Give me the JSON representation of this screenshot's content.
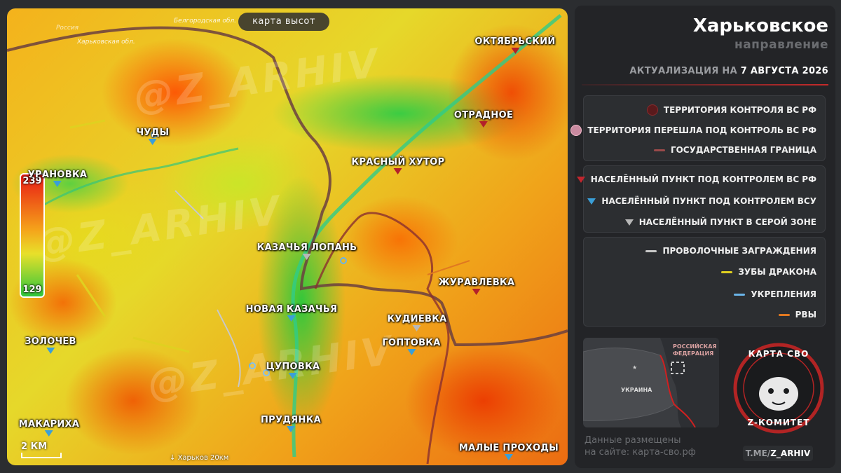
{
  "map": {
    "pill_label": "карта высот",
    "watermark": "@Z_ARHIV",
    "region_labels": {
      "border_ru": "Белгородская обл.",
      "border_ua_ru": "Россия",
      "border_ua": "Харьковская обл."
    },
    "scale_label": "2 КМ",
    "kharkiv_hint": "Харьков 20км",
    "elevation": {
      "max": "239",
      "min": "129"
    },
    "settlements": [
      {
        "name": "ОКТЯБРЬСКИЙ",
        "control": "rf"
      },
      {
        "name": "ОТРАДНОЕ",
        "control": "rf"
      },
      {
        "name": "КРАСНЫЙ ХУТОР",
        "control": "rf"
      },
      {
        "name": "ЧУДЫ",
        "control": "ua"
      },
      {
        "name": "УРАНОВКА",
        "control": "ua"
      },
      {
        "name": "КАЗАЧЬЯ ЛОПАНЬ",
        "control": "grey"
      },
      {
        "name": "ЖУРАВЛЕВКА",
        "control": "rf"
      },
      {
        "name": "НОВАЯ КАЗАЧЬЯ",
        "control": "ua"
      },
      {
        "name": "КУДИЕВКА",
        "control": "grey"
      },
      {
        "name": "ГОПТОВКА",
        "control": "ua"
      },
      {
        "name": "ЗОЛОЧЕВ",
        "control": "ua"
      },
      {
        "name": "ЦУПОВКА",
        "control": "ua"
      },
      {
        "name": "ПРУДЯНКА",
        "control": "ua"
      },
      {
        "name": "МАКАРИХА",
        "control": "ua"
      },
      {
        "name": "МАЛЫЕ ПРОХОДЫ",
        "control": "ua"
      }
    ]
  },
  "side": {
    "title": "Харьковское",
    "subtitle": "направление",
    "updated_prefix": "АКТУАЛИЗАЦИЯ НА",
    "updated_date": "7 АВГУСТА 2026",
    "legend_territory": [
      {
        "label": "ТЕРРИТОРИЯ КОНТРОЛЯ ВС РФ",
        "symbol": "circle",
        "color": "#5a1a1c",
        "border": "#8a2a2c"
      },
      {
        "label": "ТЕРРИТОРИЯ ПЕРЕШЛА ПОД КОНТРОЛЬ ВС РФ",
        "symbol": "circle",
        "color": "#c98aa0",
        "border": "#f0b8c8"
      },
      {
        "label": "ГОСУДАРСТВЕННАЯ ГРАНИЦА",
        "symbol": "line",
        "color": "#9a4a4a"
      }
    ],
    "legend_settlements": [
      {
        "label": "НАСЕЛЁННЫЙ ПУНКТ ПОД КОНТРОЛЕМ ВС РФ",
        "symbol": "triangle",
        "color": "#c0262e"
      },
      {
        "label": "НАСЕЛЁННЫЙ ПУНКТ ПОД КОНТРОЛЕМ ВСУ",
        "symbol": "triangle",
        "color": "#3a9fd8"
      },
      {
        "label": "НАСЕЛЁННЫЙ ПУНКТ В СЕРОЙ ЗОНЕ",
        "symbol": "triangle",
        "color": "#b8b8b8"
      }
    ],
    "legend_fortifications": [
      {
        "label": "ПРОВОЛОЧНЫЕ ЗАГРАЖДЕНИЯ",
        "symbol": "line",
        "color": "#c8c8c8"
      },
      {
        "label": "ЗУБЫ ДРАКОНА",
        "symbol": "line",
        "color": "#e0d020"
      },
      {
        "label": "УКРЕПЛЕНИЯ",
        "symbol": "line",
        "color": "#6ab4e8"
      },
      {
        "label": "РВЫ",
        "symbol": "line",
        "color": "#e07820"
      }
    ],
    "minimap": {
      "label_ua": "УКРАИНА",
      "label_rf_1": "РОССИЙСКАЯ",
      "label_rf_2": "ФЕДЕРАЦИЯ"
    },
    "logo": {
      "top": "КАРТА СВО",
      "bottom": "Z-КОМИТЕТ"
    },
    "source_line1": "Данные размещены",
    "source_line2": "на сайте: карта-сво.рф",
    "tg_prefix": "T.ME/",
    "tg_handle": "Z_ARHIV"
  }
}
